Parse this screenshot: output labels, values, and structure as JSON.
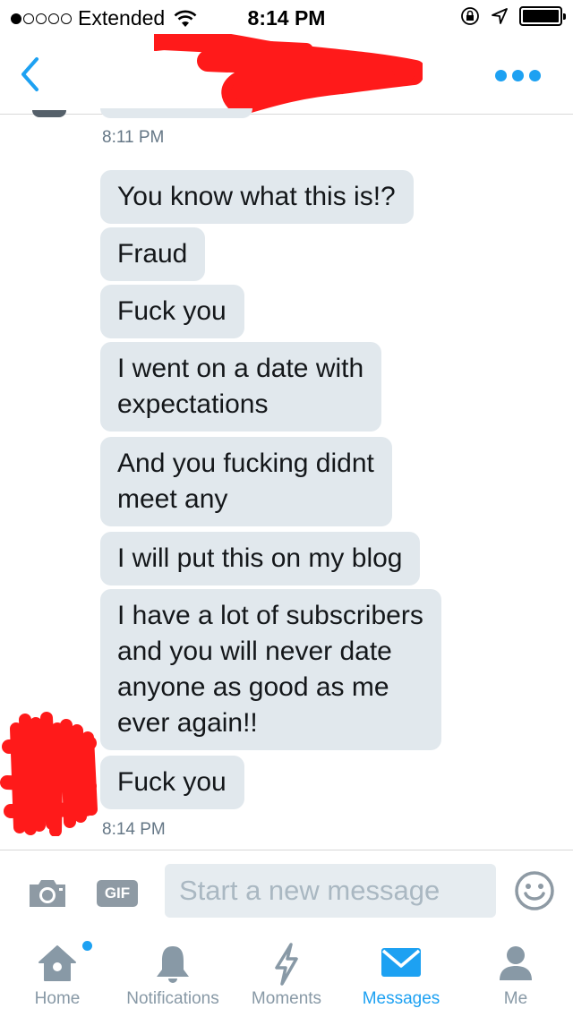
{
  "status_bar": {
    "carrier": "Extended",
    "signal_bars_filled": 1,
    "signal_bars_total": 5,
    "time": "8:14 PM"
  },
  "header": {
    "back_icon": "chevron-left-icon",
    "more_icon": "more-dots-icon",
    "accent_color": "#1da1f2"
  },
  "conversation": {
    "timestamp_top": "8:11 PM",
    "messages": [
      "You know what this is!?",
      "Fraud",
      "Fuck you",
      "I went on a date with\nexpectations",
      "And you fucking didnt\nmeet any",
      "I will put this on my blog",
      "I have a lot of subscribers\nand you will never date\nanyone as good as me\never again!!",
      "Fuck you"
    ],
    "timestamp_bottom": "8:14 PM",
    "bubble_color": "#e1e8ed"
  },
  "composer": {
    "gif_label": "GIF",
    "placeholder": "Start a new message"
  },
  "tabs": [
    {
      "label": "Home",
      "icon": "home-icon",
      "active": false
    },
    {
      "label": "Notifications",
      "icon": "bell-icon",
      "active": false
    },
    {
      "label": "Moments",
      "icon": "lightning-icon",
      "active": false
    },
    {
      "label": "Messages",
      "icon": "envelope-icon",
      "active": true
    },
    {
      "label": "Me",
      "icon": "person-icon",
      "active": false
    }
  ]
}
